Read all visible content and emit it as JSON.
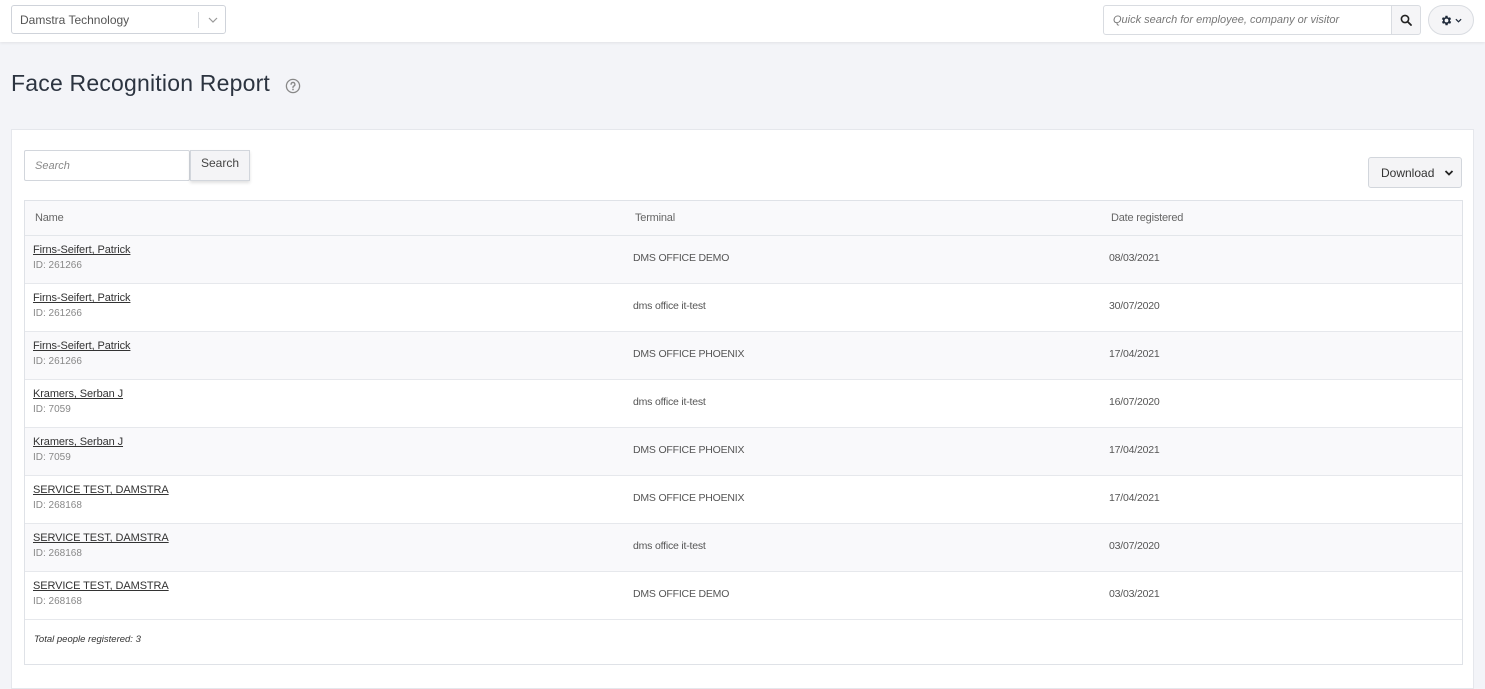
{
  "topbar": {
    "company_selected": "Damstra Technology",
    "quick_search_placeholder": "Quick search for employee, company or visitor",
    "icons": {
      "search": "search-icon",
      "settings": "gear-icon",
      "dropdown": "chevron-down-icon"
    }
  },
  "page": {
    "title": "Face Recognition Report",
    "help_icon": "question-circle-icon"
  },
  "filters": {
    "search_placeholder": "Search",
    "search_button": "Search",
    "download_label": "Download"
  },
  "table": {
    "columns": [
      "Name",
      "Terminal",
      "Date registered"
    ],
    "rows": [
      {
        "name": "Firns-Seifert, Patrick",
        "id": "ID: 261266",
        "terminal": "DMS OFFICE DEMO",
        "date": "08/03/2021"
      },
      {
        "name": "Firns-Seifert, Patrick",
        "id": "ID: 261266",
        "terminal": "dms office it-test",
        "date": "30/07/2020"
      },
      {
        "name": "Firns-Seifert, Patrick",
        "id": "ID: 261266",
        "terminal": "DMS OFFICE PHOENIX",
        "date": "17/04/2021"
      },
      {
        "name": "Kramers, Serban J",
        "id": "ID: 7059",
        "terminal": "dms office it-test",
        "date": "16/07/2020"
      },
      {
        "name": "Kramers, Serban J",
        "id": "ID: 7059",
        "terminal": "DMS OFFICE PHOENIX",
        "date": "17/04/2021"
      },
      {
        "name": "SERVICE TEST, DAMSTRA",
        "id": "ID: 268168",
        "terminal": "DMS OFFICE PHOENIX",
        "date": "17/04/2021"
      },
      {
        "name": "SERVICE TEST, DAMSTRA",
        "id": "ID: 268168",
        "terminal": "dms office it-test",
        "date": "03/07/2020"
      },
      {
        "name": "SERVICE TEST, DAMSTRA",
        "id": "ID: 268168",
        "terminal": "DMS OFFICE DEMO",
        "date": "03/03/2021"
      }
    ],
    "total_label": "Total people registered: 3"
  }
}
